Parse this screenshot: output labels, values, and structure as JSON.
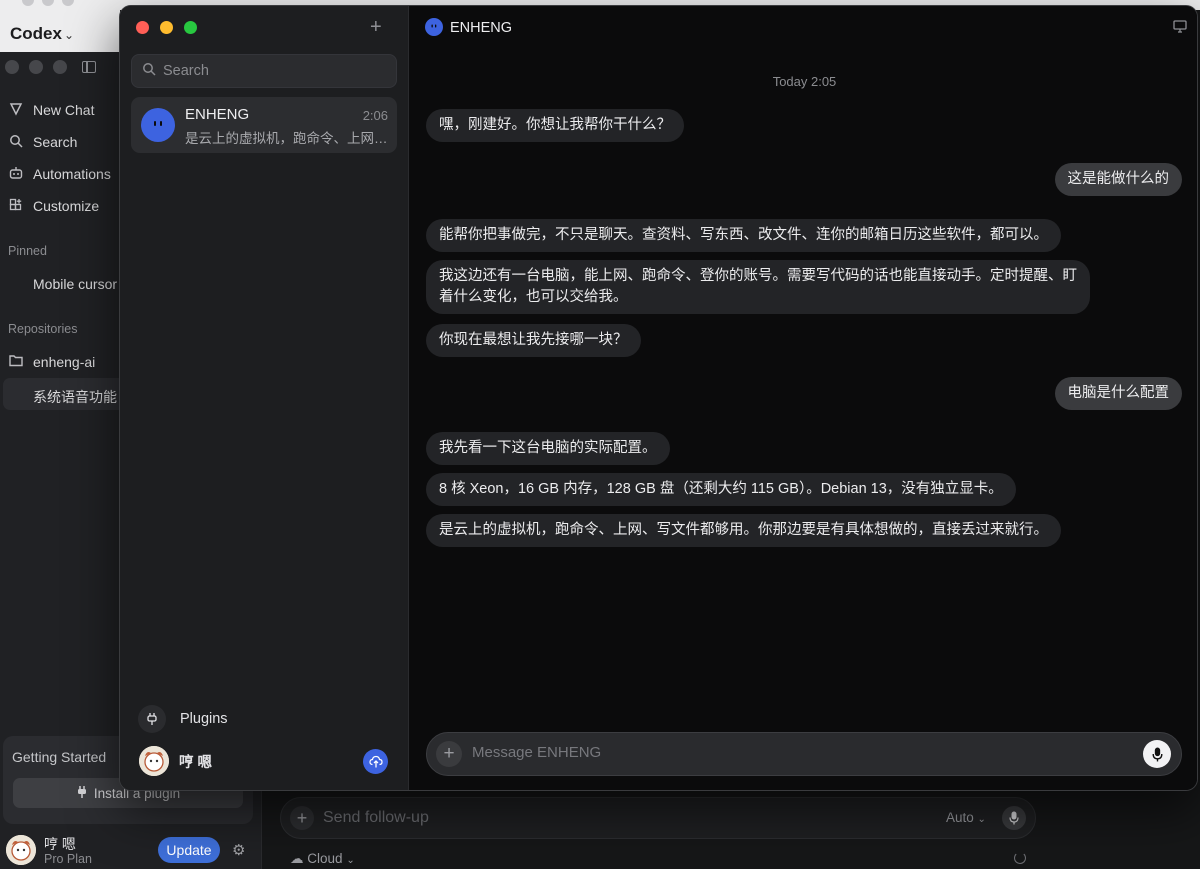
{
  "background_app": {
    "app_title": "Codex",
    "nav": [
      {
        "label": "New Chat",
        "icon": "new-chat-icon"
      },
      {
        "label": "Search",
        "icon": "search-icon"
      },
      {
        "label": "Automations",
        "icon": "robot-icon"
      },
      {
        "label": "Customize",
        "icon": "grid-plus-icon"
      }
    ],
    "pinned_label": "Pinned",
    "pinned_item": "Mobile cursor",
    "repositories_label": "Repositories",
    "repo": "enheng-ai",
    "repo_sub": "系统语音功能",
    "getting_started": {
      "title": "Getting Started",
      "button": "Install a plugin"
    },
    "user": {
      "name": "哼 嗯",
      "plan": "Pro Plan"
    },
    "update_label": "Update",
    "composer": {
      "placeholder": "Send follow-up",
      "mode": "Auto"
    },
    "cloud_label": "Cloud"
  },
  "chat_window": {
    "search_placeholder": "Search",
    "conversation": {
      "name": "ENHENG",
      "time": "2:06",
      "preview": "是云上的虚拟机，跑命令、上网、写文件都够用。你那边要是有具体想做的，直接丢过来就行。"
    },
    "plugins_label": "Plugins",
    "user_name": "哼 嗯",
    "header_title": "ENHENG",
    "date_label": "Today 2:05",
    "messages": [
      {
        "role": "assistant",
        "text": "嘿，刚建好。你想让我帮你干什么？"
      },
      {
        "role": "user",
        "text": "这是能做什么的"
      },
      {
        "role": "assistant",
        "text": "能帮你把事做完，不只是聊天。查资料、写东西、改文件、连你的邮箱日历这些软件，都可以。"
      },
      {
        "role": "assistant",
        "text": "我这边还有一台电脑，能上网、跑命令、登你的账号。需要写代码的话也能直接动手。定时提醒、盯着什么变化，也可以交给我。"
      },
      {
        "role": "assistant",
        "text": "你现在最想让我先接哪一块？"
      },
      {
        "role": "user",
        "text": "电脑是什么配置"
      },
      {
        "role": "assistant",
        "text": "我先看一下这台电脑的实际配置。"
      },
      {
        "role": "assistant",
        "text": "8 核 Xeon，16 GB 内存，128 GB 盘（还剩大约 115 GB）。Debian 13，没有独立显卡。"
      },
      {
        "role": "assistant",
        "text": "是云上的虚拟机，跑命令、上网、写文件都够用。你那边要是有具体想做的，直接丢过来就行。"
      }
    ],
    "composer_placeholder": "Message ENHENG"
  },
  "colors": {
    "accent_blue": "#3d63e0",
    "traffic_red": "#ff5f57",
    "traffic_yellow": "#febc2e",
    "traffic_green": "#28c840"
  }
}
